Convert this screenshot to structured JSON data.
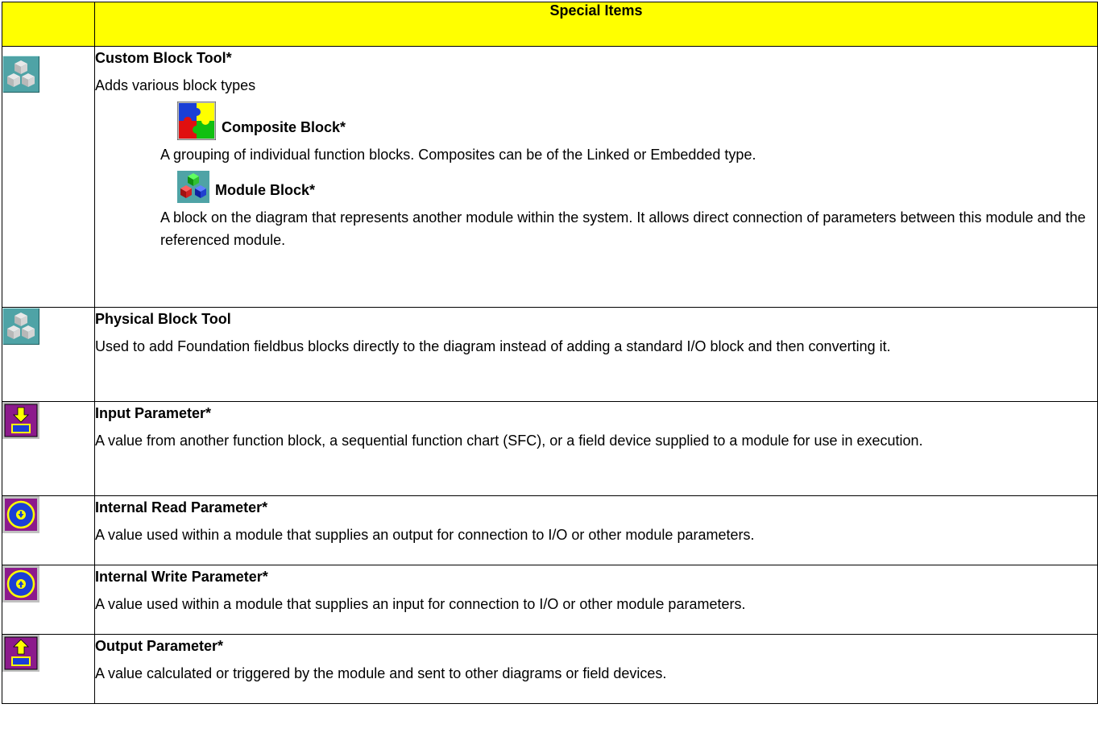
{
  "header": {
    "title": "Special Items"
  },
  "rows": [
    {
      "icon": "cubes-icon",
      "title": "Custom Block Tool*",
      "text": "Adds various block types",
      "subitems": [
        {
          "icon": "puzzle-icon",
          "title": "Composite Block*",
          "text": "A grouping of individual function blocks. Composites can be of the Linked or Embedded type."
        },
        {
          "icon": "color-cubes-icon",
          "title": "Module Block*",
          "text": "A block on the diagram that represents another module within the system. It allows direct connection of parameters between this module and the referenced module."
        }
      ]
    },
    {
      "icon": "cubes-icon",
      "title": "Physical Block Tool",
      "text": "Used to add Foundation fieldbus blocks directly to the diagram instead of adding a standard I/O block and then converting it."
    },
    {
      "icon": "input-arrow-icon",
      "title": "Input Parameter*",
      "text": "A value from another function block, a sequential function chart (SFC), or a field device supplied to a module for use in execution."
    },
    {
      "icon": "read-circle-icon",
      "title": "Internal Read Parameter*",
      "text": "A value used within a module that supplies an output for connection to I/O or other module parameters."
    },
    {
      "icon": "write-circle-icon",
      "title": "Internal Write Parameter*",
      "text": "A value used within a module that supplies an input for connection to I/O or other module parameters."
    },
    {
      "icon": "output-arrow-icon",
      "title": "Output Parameter*",
      "text": "A value calculated or triggered by the module and sent to other diagrams or field devices."
    }
  ],
  "colors": {
    "header_bg": "#ffff00",
    "icon_teal": "#4fa3a6",
    "icon_purple": "#8c1a8c",
    "icon_yellow": "#ffff00",
    "icon_blue": "#1a3fd6"
  }
}
